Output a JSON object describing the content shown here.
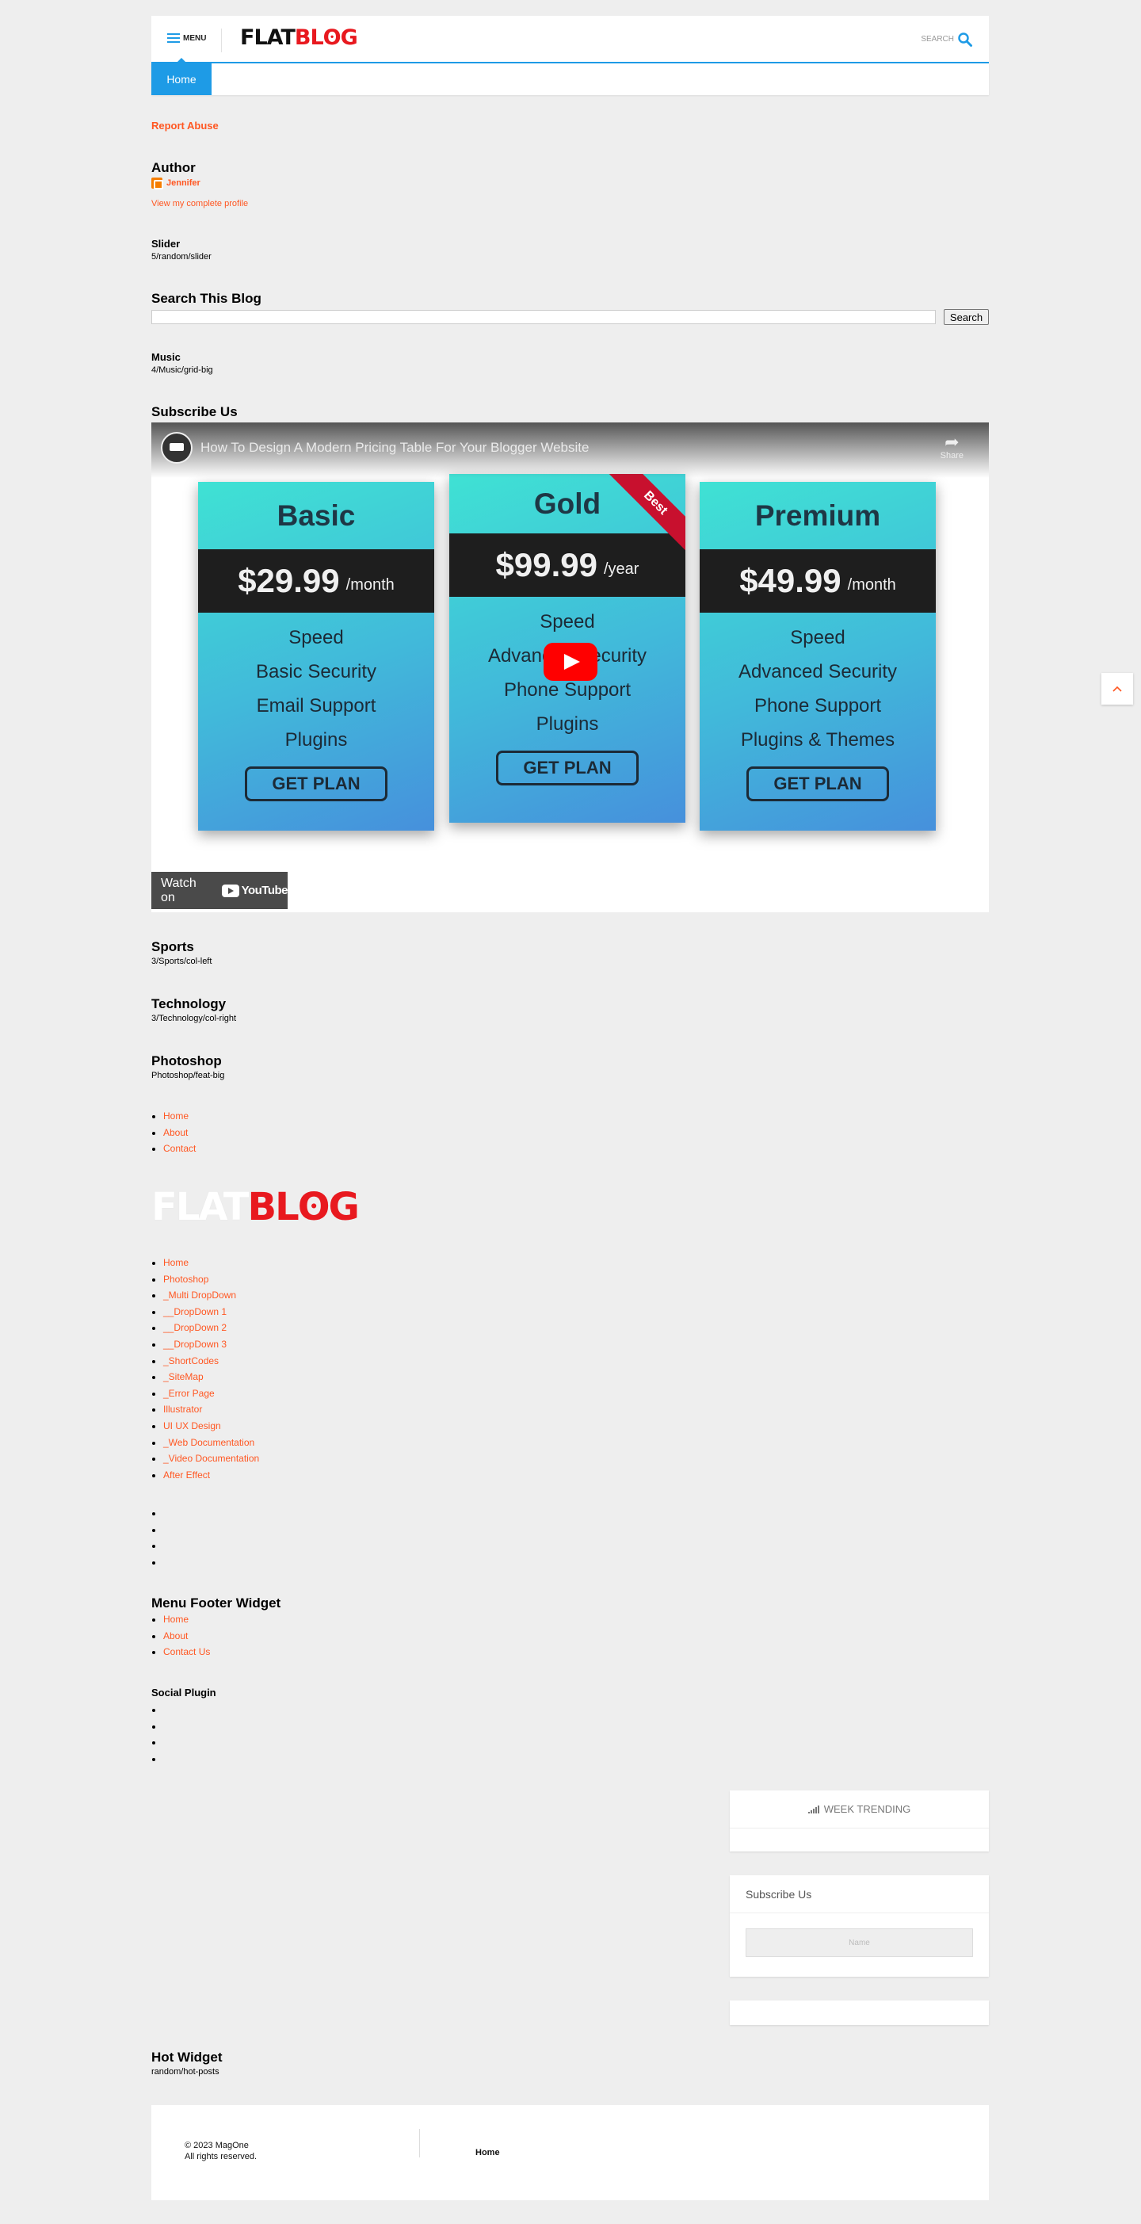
{
  "header": {
    "menu_label": "MENU",
    "logo_flat": "FLAT",
    "logo_blog": "BLʘG",
    "search_label": "SEARCH"
  },
  "nav": {
    "home_label": "Home"
  },
  "report_abuse": "Report Abuse",
  "author": {
    "title": "Author",
    "name": "Jennifer",
    "profile_link": "View my complete profile"
  },
  "slider": {
    "title": "Slider",
    "value": "5/random/slider"
  },
  "search_blog": {
    "title": "Search This Blog",
    "input_value": "",
    "button_label": "Search"
  },
  "music": {
    "title": "Music",
    "value": "4/Music/grid-big"
  },
  "subscribe_us": {
    "title": "Subscribe Us"
  },
  "video": {
    "title": "How To Design A Modern Pricing Table For Your Blogger Website",
    "share_label": "Share",
    "watch_on": "Watch on",
    "youtube_label": "YouTube",
    "plans": [
      {
        "name": "Basic",
        "price": "$29.99",
        "period": "/month",
        "features": [
          "Speed",
          "Basic Security",
          "Email Support",
          "Plugins"
        ],
        "button": "GET PLAN"
      },
      {
        "name": "Gold",
        "price": "$99.99",
        "period": "/year",
        "features": [
          "Speed",
          "Advanced Security",
          "Phone Support",
          "Plugins"
        ],
        "button": "GET PLAN",
        "ribbon": "Best"
      },
      {
        "name": "Premium",
        "price": "$49.99",
        "period": "/month",
        "features": [
          "Speed",
          "Advanced Security",
          "Phone Support",
          "Plugins & Themes"
        ],
        "button": "GET PLAN"
      }
    ]
  },
  "sports": {
    "title": "Sports",
    "value": "3/Sports/col-left"
  },
  "technology": {
    "title": "Technology",
    "value": "3/Technology/col-right"
  },
  "photoshop": {
    "title": "Photoshop",
    "value": "Photoshop/feat-big"
  },
  "top_links": [
    "Home",
    "About",
    "Contact"
  ],
  "footer_logo": {
    "flat": "FLAT",
    "blog": "BLʘG"
  },
  "main_menu": [
    "Home",
    "Photoshop",
    "_Multi DropDown",
    "__DropDown 1",
    "__DropDown 2",
    "__DropDown 3",
    "_ShortCodes",
    "_SiteMap",
    "_Error Page",
    "Illustrator",
    "UI UX Design",
    "_Web Documentation",
    "_Video Documentation",
    "After Effect"
  ],
  "menu_footer_widget": {
    "title": "Menu Footer Widget",
    "links": [
      "Home",
      "About",
      "Contact Us"
    ]
  },
  "social_plugin": {
    "title": "Social Plugin"
  },
  "sidebar": {
    "week_trending": "WEEK TRENDING",
    "subscribe_title": "Subscribe Us",
    "subscribe_placeholder": "Name"
  },
  "hot_widget": {
    "title": "Hot Widget",
    "value": "random/hot-posts"
  },
  "footer": {
    "copyright": "© 2023 MagOne",
    "rights": "All rights reserved.",
    "home_link": "Home"
  },
  "colors": {
    "accent": "#1e9be6",
    "link": "#ff5722",
    "logo_red": "#e8191f"
  }
}
